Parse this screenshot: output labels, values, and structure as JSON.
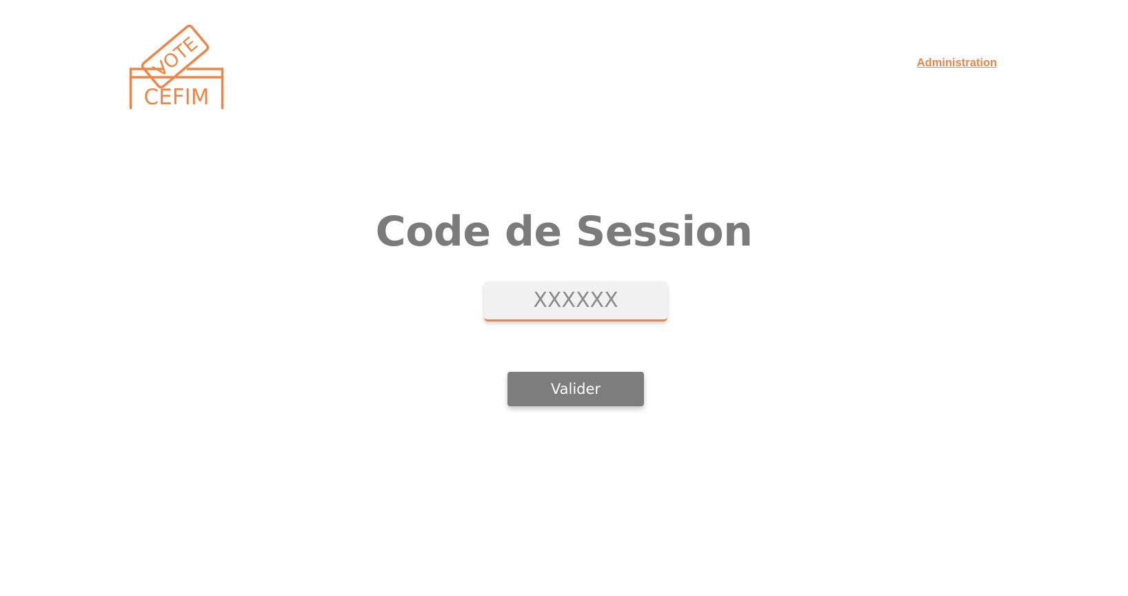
{
  "header": {
    "logo": {
      "ballot_text": "VOTE",
      "box_text": "CEFIM",
      "icon": "ballot-box-icon"
    },
    "admin_link": "Administration"
  },
  "main": {
    "title": "Code de Session",
    "session_input": {
      "placeholder": "XXXXXX",
      "value": ""
    },
    "submit_label": "Valider"
  },
  "colors": {
    "accent": "#ef8544",
    "text_gray": "#7b7b7b",
    "button_bg": "#7d7d7d",
    "input_bg": "#f1f1f1",
    "background": "#ffffff"
  }
}
